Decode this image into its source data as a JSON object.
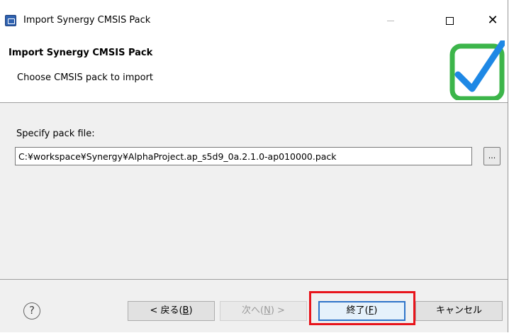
{
  "window": {
    "title": "Import Synergy CMSIS Pack",
    "icon": "eclipse-app-icon",
    "controls": {
      "minimize": "minimize-icon",
      "maximize": "maximize-icon",
      "close": "close-icon"
    }
  },
  "banner": {
    "title": "Import Synergy CMSIS Pack",
    "description": "Choose CMSIS pack to import",
    "logo": "checkmark-logo",
    "logo_colors": {
      "frame": "#3cb54a",
      "check": "#1e88e5"
    }
  },
  "form": {
    "label": "Specify pack file:",
    "file_path": "C:¥workspace¥Synergy¥AlphaProject.ap_s5d9_0a.2.1.0-ap010000.pack",
    "browse_label": "..."
  },
  "footer": {
    "help_icon": "help-icon",
    "back": {
      "prefix": "< 戻る(",
      "key": "B",
      "suffix": ")"
    },
    "next": {
      "prefix": "次へ(",
      "key": "N",
      "suffix": ") >"
    },
    "finish": {
      "prefix": "終了(",
      "key": "F",
      "suffix": ")"
    },
    "cancel": "キャンセル",
    "highlight_color": "#e8141b"
  }
}
